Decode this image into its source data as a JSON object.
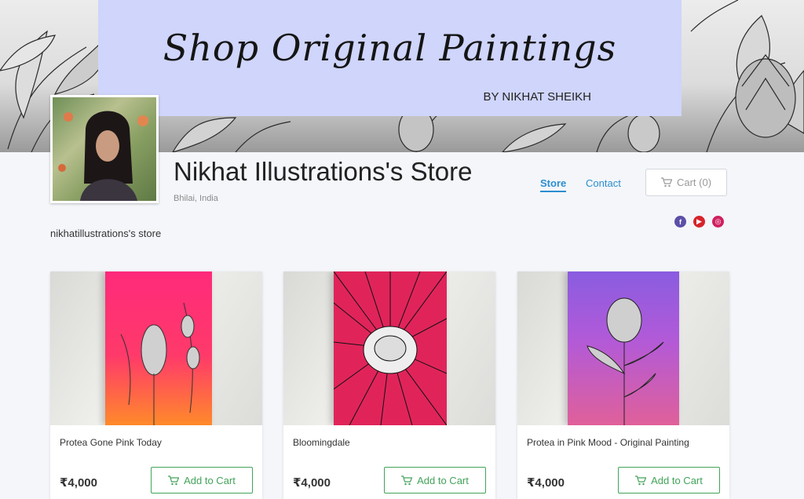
{
  "banner": {
    "title": "Shop Original Paintings",
    "subtitle": "BY NIKHAT SHEIKH"
  },
  "store": {
    "name": "Nikhat Illustrations's Store",
    "location": "Bhilai, India",
    "description": "nikhatillustrations's store"
  },
  "nav": {
    "store": "Store",
    "contact": "Contact",
    "cart": "Cart (0)"
  },
  "social": [
    "facebook-icon",
    "youtube-icon",
    "instagram-icon"
  ],
  "colors": {
    "accent": "#2b8ecf",
    "add_to_cart": "#43a35a",
    "banner_card": "#cfd5fb"
  },
  "products": [
    {
      "name": "Protea Gone Pink Today",
      "price": "₹4,000",
      "button": "Add to Cart"
    },
    {
      "name": "Bloomingdale",
      "price": "₹4,000",
      "button": "Add to Cart"
    },
    {
      "name": "Protea in Pink Mood - Original Painting",
      "price": "₹4,000",
      "button": "Add to Cart"
    }
  ]
}
